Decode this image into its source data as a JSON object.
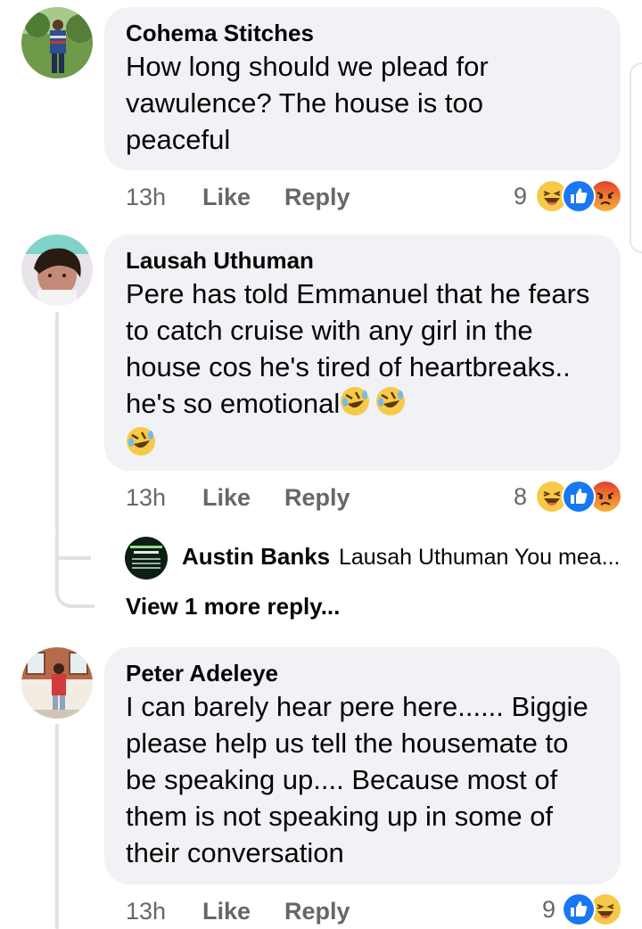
{
  "comments": [
    {
      "author": "Cohema Stitches",
      "text": "How long should we plead for vawulence? The house is too peaceful",
      "time": "13h",
      "like": "Like",
      "reply": "Reply",
      "reaction_count": "9",
      "reactions": [
        "laugh-emoji",
        "like-icon",
        "angry-emoji"
      ]
    },
    {
      "author": "Lausah Uthuman",
      "text": "Pere has told Emmanuel that he fears to catch cruise with any girl in the house cos he's tired of heartbreaks.. he's so emotional",
      "time": "13h",
      "like": "Like",
      "reply": "Reply",
      "reaction_count": "8",
      "reactions": [
        "laugh-emoji",
        "like-icon",
        "angry-emoji"
      ],
      "reply_preview": {
        "author": "Austin Banks",
        "text": "Lausah Uthuman You mea...",
        "avatar_text": "QUARANTINE IN THE BIBLE"
      },
      "view_more": "View 1 more reply..."
    },
    {
      "author": "Peter Adeleye",
      "text": "I can barely hear pere here...... Biggie please help us tell the housemate to be speaking up.... Because most of them is not speaking up in some of their conversation",
      "time": "13h",
      "like": "Like",
      "reply": "Reply",
      "reaction_count": "9",
      "reactions": [
        "like-icon",
        "laugh-emoji"
      ]
    }
  ],
  "colors": {
    "bubble_bg": "#f0f2f5",
    "meta_text": "#65676b",
    "like_blue": "#1877f2",
    "haha_yellow": "#f7c948",
    "angry_orange": "#e9710f",
    "thread_line": "#dfe1e5"
  }
}
